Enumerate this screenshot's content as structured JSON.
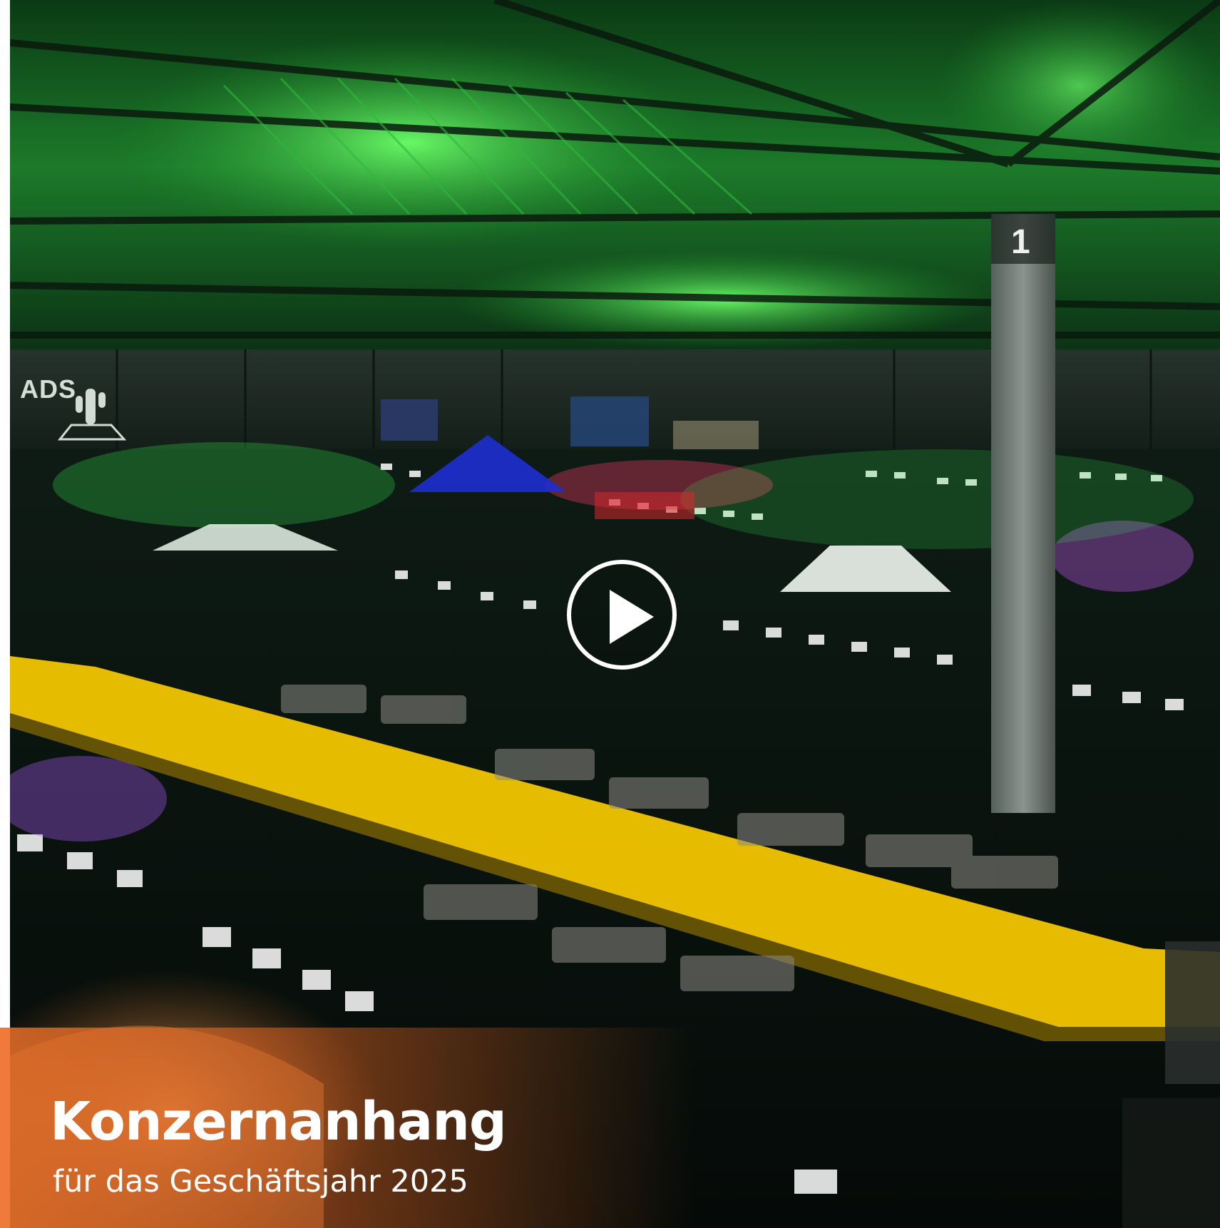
{
  "document": {
    "title": "Konzernanhang",
    "subtitle": "für das Geschäftsjahr 2025"
  },
  "photo": {
    "wall_sign": "ADS",
    "pillar_number": "1"
  },
  "video": {
    "play_icon": "play-icon"
  },
  "colors": {
    "accent": "#f07a3c",
    "ceiling_green": "#3dff5a",
    "floor_yellow": "#f2c500"
  }
}
